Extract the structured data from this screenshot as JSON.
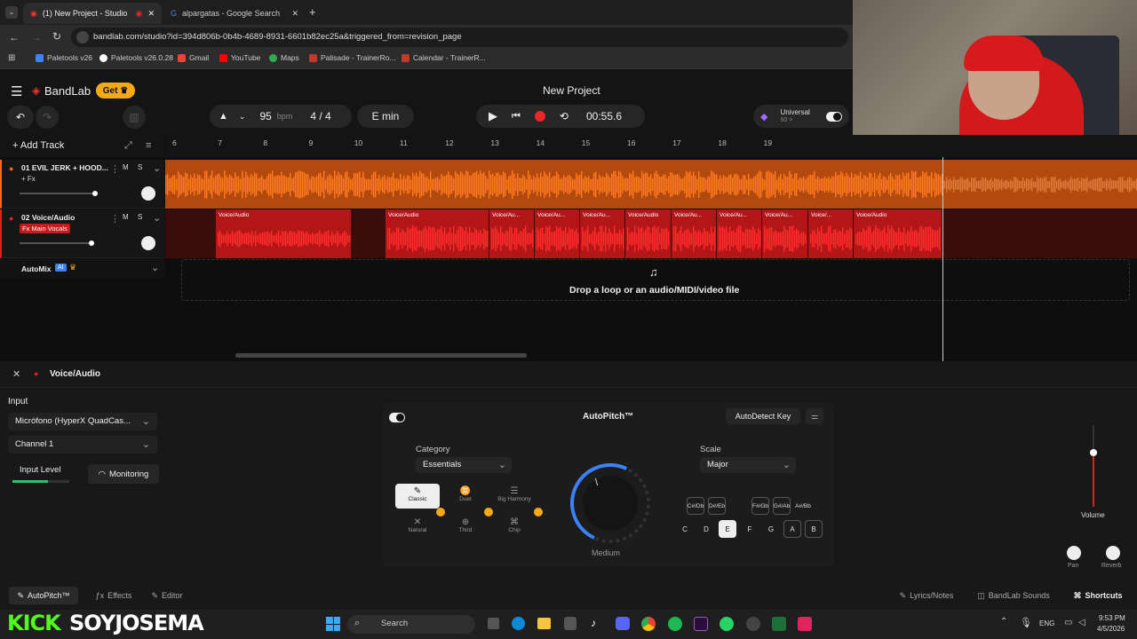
{
  "browser": {
    "tabs": [
      {
        "title": "(1) New Project - Studio",
        "active": true
      },
      {
        "title": "alpargatas - Google Search",
        "active": false
      }
    ],
    "url": "bandlab.com/studio?id=394d806b-0b4b-4689-8931-6601b82ec25a&triggered_from=revision_page",
    "bookmarks": [
      "Paletools v26",
      "Paletools v26.0.28",
      "Gmail",
      "YouTube",
      "Maps",
      "Palisade - TrainerRo...",
      "Calendar - TrainerR..."
    ]
  },
  "studio": {
    "logo": "BandLab",
    "get_label": "Get",
    "project_title": "New Project",
    "bpm": "95",
    "bpm_unit": "bpm",
    "time_sig": "4 / 4",
    "key": "E min",
    "time": "00:55.6",
    "universal_label": "Universal",
    "universal_sub": "50 >",
    "add_track": "Add Track",
    "ruler": [
      "6",
      "7",
      "8",
      "9",
      "10",
      "11",
      "12",
      "13",
      "14",
      "15",
      "16",
      "17",
      "18",
      "19"
    ],
    "tracks": [
      {
        "name": "01  EVIL JERK + HOOD...",
        "badge": "+ Fx",
        "m": "M",
        "s": "S"
      },
      {
        "name": "02  Voice/Audio",
        "badge": "Fx Main Vocals",
        "m": "M",
        "s": "S"
      }
    ],
    "clip_labels": [
      "Voice/Audio",
      "Voice/Audio",
      "Voice/Au...",
      "Voice/Au...",
      "Voice/Au...",
      "Voice/Audio",
      "Voice/Au...",
      "Voice/Au...",
      "Voice/Au...",
      "Voice/...",
      "Voice/Audio"
    ],
    "automix": "AutoMix",
    "automix_badge": "AI",
    "drop_text": "Drop a loop or an audio/MIDI/video file"
  },
  "panel": {
    "title": "Voice/Audio",
    "input_label": "Input",
    "input_device": "Micrófono (HyperX QuadCas...",
    "channel": "Channel 1",
    "input_level": "Input Level",
    "monitoring": "Monitoring",
    "autopitch_title": "AutoPitch™",
    "autodetect": "AutoDetect Key",
    "category_label": "Category",
    "category_value": "Essentials",
    "presets": [
      "Classic",
      "Duet",
      "Big Harmony",
      "Natural",
      "Third",
      "Chip"
    ],
    "knob_label": "Medium",
    "scale_label": "Scale",
    "scale_value": "Major",
    "sharps_top": [
      "C#/Db",
      "D#/Eb",
      "F#/Gb",
      "G#/Ab",
      "A#/Bb"
    ],
    "notes": [
      "C",
      "D",
      "E",
      "F",
      "G",
      "A",
      "B"
    ],
    "volume_label": "Volume",
    "pan_label": "Pan",
    "reverb_label": "Reverb"
  },
  "bottom_tabs": {
    "autopitch": "AutoPitch™",
    "effects": "Effects",
    "editor": "Editor",
    "lyrics": "Lyrics/Notes",
    "sounds": "BandLab Sounds",
    "shortcuts": "Shortcuts"
  },
  "overlay": {
    "kick": "KICK",
    "name": "SOYJOSEMA"
  },
  "taskbar": {
    "search": "Search",
    "lang": "ENG",
    "time": "9:53 PM",
    "date": "4/5/2026"
  },
  "colors": {
    "accent": "#ff6a1a",
    "record": "#e8262a",
    "clip_red": "#e01f1f",
    "brand": "#f2392c"
  }
}
